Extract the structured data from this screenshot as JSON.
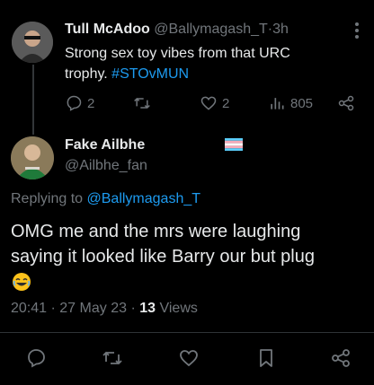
{
  "reply_to_tweet": {
    "author_name": "Tull McAdoo",
    "handle": "@Ballymagash_T",
    "separator": "·",
    "time": "3h",
    "text_line1": "Strong sex toy vibes from that URC",
    "text_line2_prefix": "trophy. ",
    "hashtag": "#STOvMUN",
    "reply_count": "2",
    "like_count": "2",
    "view_count": "805"
  },
  "main_tweet": {
    "author_name": "Fake Ailbhe",
    "name_emoji": "🏳️‍⚧️",
    "handle": "@Ailbhe_fan",
    "replying_to_prefix": "Replying to ",
    "replying_to_handle": "@Ballymagash_T",
    "text_line1": "OMG me and the mrs were laughing",
    "text_line2": "saying it looked like Barry our but plug",
    "text_emoji": "😂",
    "time": "20:41",
    "date_separator": "·",
    "date": "27 May 23",
    "views_separator": "·",
    "view_count": "13",
    "views_label": "Views"
  },
  "icons": {
    "reply": "reply-icon",
    "retweet": "retweet-icon",
    "like": "like-icon",
    "views": "views-icon",
    "share": "share-icon",
    "bookmark": "bookmark-icon"
  },
  "colors": {
    "background": "#000000",
    "text": "#e7e9ea",
    "muted": "#71767b",
    "link": "#1d9bf0",
    "divider": "#2f3336"
  }
}
